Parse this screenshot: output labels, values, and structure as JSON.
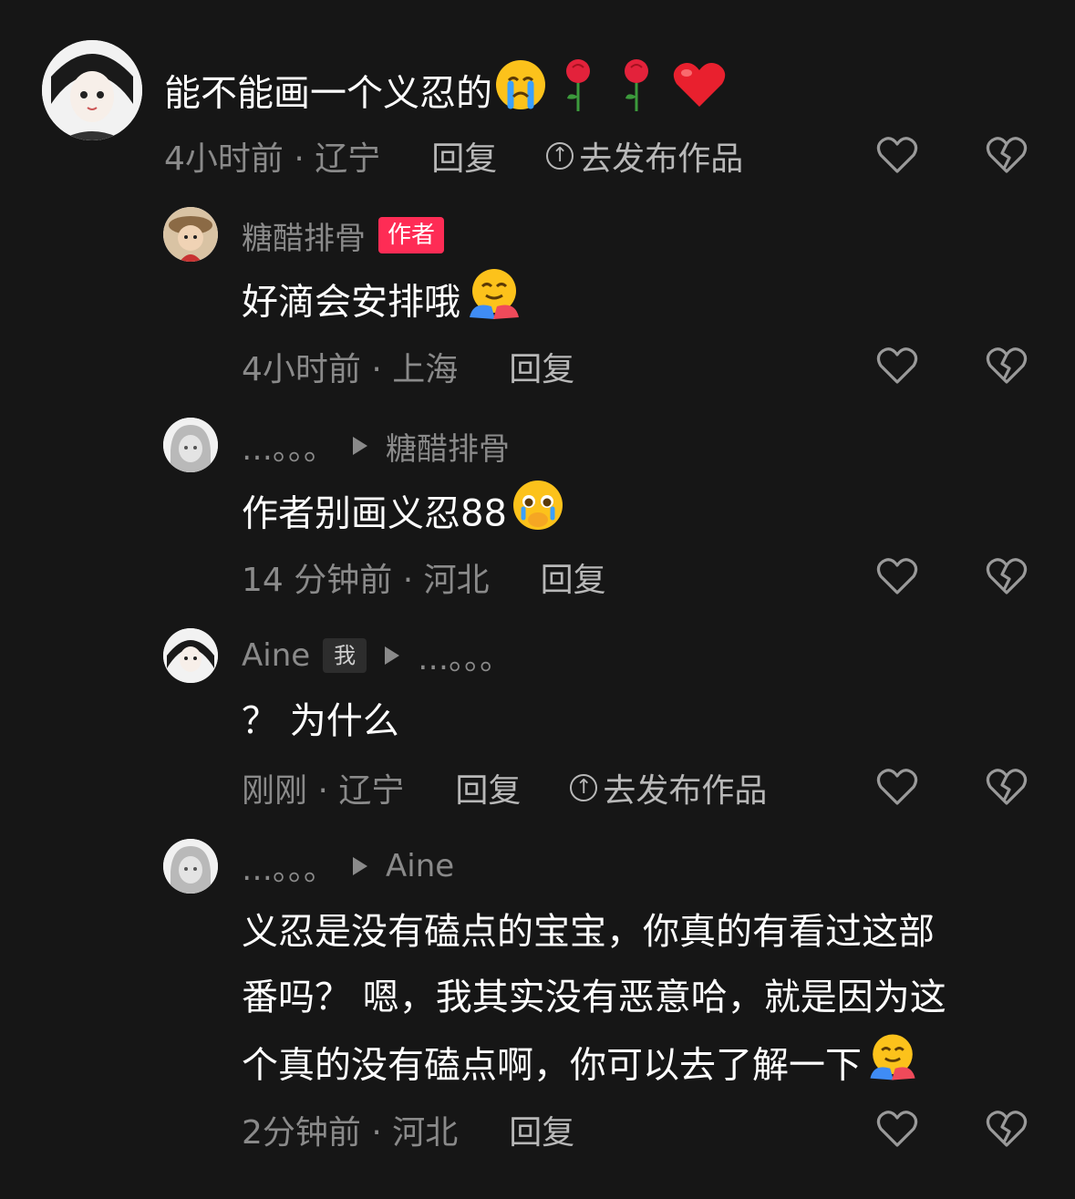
{
  "comments": [
    {
      "text": "能不能画一个义忍的",
      "time_location": "4小时前 · 辽宁",
      "reply": "回复",
      "publish": "去发布作品"
    },
    {
      "author": "糖醋排骨",
      "badge": "作者",
      "text": "好滴会安排哦",
      "time_location": "4小时前 · 上海",
      "reply": "回复"
    },
    {
      "author": "…。。。",
      "reply_to": "糖醋排骨",
      "text": "作者别画义忍88",
      "time_location": "14 分钟前 · 河北",
      "reply": "回复"
    },
    {
      "author": "Aine",
      "badge": "我",
      "reply_to": "…。。。",
      "text": "？ 为什么",
      "time_location": "刚刚 · 辽宁",
      "reply": "回复",
      "publish": "去发布作品"
    },
    {
      "author": "…。。。",
      "reply_to": "Aine",
      "text_lines": [
        "义忍是没有磕点的宝宝，你真的有看过这部",
        "番吗？  嗯，我其实没有恶意哈，就是因为这",
        "个真的没有磕点啊，你可以去了解一下"
      ],
      "time_location": "2分钟前 · 河北",
      "reply": "回复"
    }
  ],
  "icons": {
    "like": "heart-outline-icon",
    "dislike": "broken-heart-icon",
    "publish": "upload-circle-icon",
    "reply_arrow": "play-triangle-icon"
  },
  "colors": {
    "background": "#161616",
    "author_badge": "#fe2c55",
    "muted": "#8a8a8a"
  }
}
